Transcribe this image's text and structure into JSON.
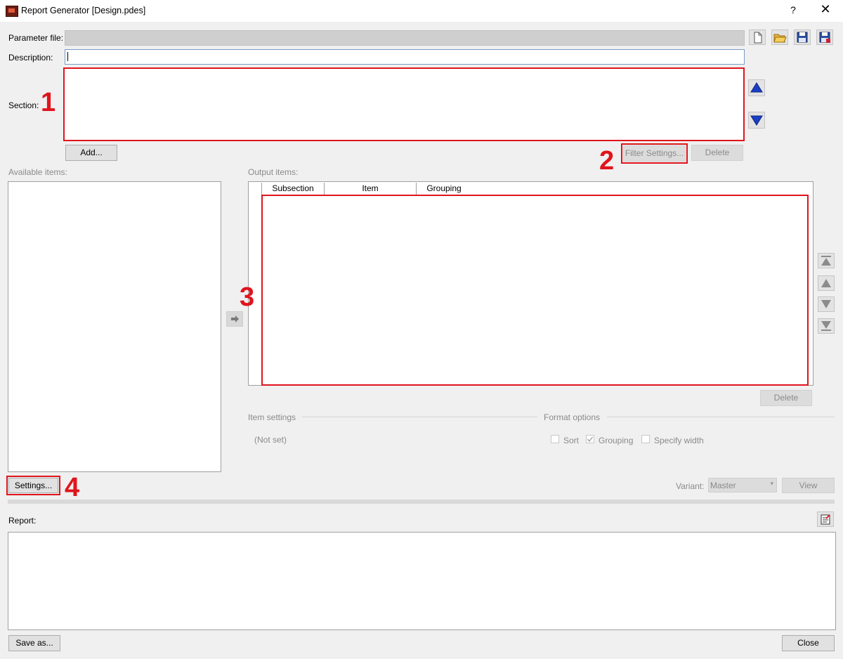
{
  "window": {
    "title": "Report Generator [Design.pdes]",
    "help_glyph": "?",
    "close_glyph": "✕"
  },
  "param": {
    "label": "Parameter file:",
    "value": "",
    "toolbar_icons": [
      "new-file-icon",
      "open-folder-icon",
      "save-icon",
      "save-as-icon"
    ]
  },
  "description": {
    "label": "Description:",
    "value": ""
  },
  "section": {
    "label": "Section:",
    "add_label": "Add...",
    "filter_label": "Filter Settings...",
    "delete_label": "Delete"
  },
  "available": {
    "label": "Available items:",
    "settings_label": "Settings..."
  },
  "output": {
    "label": "Output items:",
    "columns": [
      "Subsection",
      "Item",
      "Grouping"
    ],
    "delete_label": "Delete"
  },
  "item_settings": {
    "label": "Item settings",
    "value": "(Not set)"
  },
  "format_options": {
    "label": "Format options",
    "sort_label": "Sort",
    "grouping_label": "Grouping",
    "grouping_checked": true,
    "width_label": "Specify width"
  },
  "variant": {
    "label": "Variant:",
    "value": "Master",
    "view_label": "View"
  },
  "report": {
    "label": "Report:",
    "save_label": "Save as...",
    "close_label": "Close"
  },
  "annotations": [
    "1",
    "2",
    "3",
    "4"
  ],
  "colors": {
    "accent": "#e0141c",
    "arrow_blue": "#1a3fc4"
  }
}
